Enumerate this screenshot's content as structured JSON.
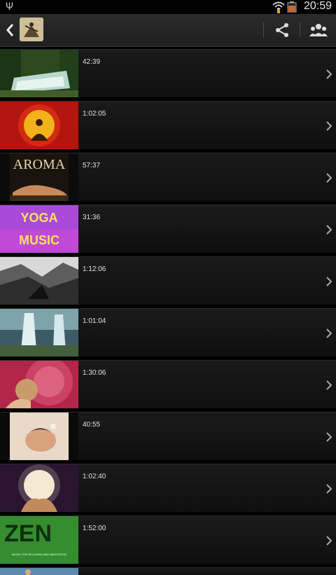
{
  "status_bar": {
    "time": "20:59"
  },
  "action_bar": {
    "icons": [
      "back-icon",
      "app-icon",
      "share-icon",
      "group-icon"
    ]
  },
  "list": {
    "items": [
      {
        "duration": "42:39",
        "thumb": "waterfall-forest"
      },
      {
        "duration": "1:02:05",
        "thumb": "meditation-om"
      },
      {
        "duration": "57:37",
        "thumb": "aroma",
        "thumb_text": "AROMA"
      },
      {
        "duration": "31:36",
        "thumb": "yoga-music",
        "thumb_text": "YOGA MUSIC"
      },
      {
        "duration": "1:12:06",
        "thumb": "mountain-valley"
      },
      {
        "duration": "1:01:04",
        "thumb": "waterfall-blue"
      },
      {
        "duration": "1:30:06",
        "thumb": "mandala-hands"
      },
      {
        "duration": "40:55",
        "thumb": "spa-woman"
      },
      {
        "duration": "1:02:40",
        "thumb": "glowing-hands"
      },
      {
        "duration": "1:52:00",
        "thumb": "zen",
        "thumb_text": "ZEN",
        "thumb_subtext": "MUSIC FOR RELAXING AND MEDITATION"
      },
      {
        "duration": "",
        "thumb": "partial"
      }
    ]
  },
  "colors": {
    "background": "#000000",
    "action_bar": "#262626",
    "row": "#141414",
    "text": "#e0e0e0"
  }
}
